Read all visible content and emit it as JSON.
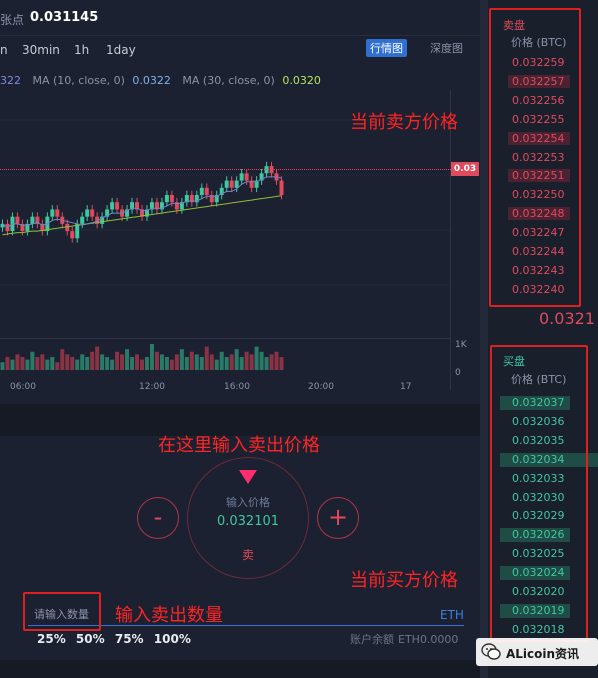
{
  "header": {
    "label": "张点",
    "price": "0.031145"
  },
  "intervals": [
    "n",
    "30min",
    "1h",
    "1day"
  ],
  "chart_tabs": {
    "active": "行情图",
    "inactive": "深度图"
  },
  "ma": {
    "ma_first_value": "322",
    "ma10_label": "MA (10, close, 0)",
    "ma10_value": "0.0322",
    "ma30_label": "MA (30, close, 0)",
    "ma30_value": "0.0320"
  },
  "current_price_tag": "0.03",
  "volume_axis": {
    "top": "1K",
    "bottom": "0"
  },
  "time_axis": [
    "06:00",
    "12:00",
    "16:00",
    "20:00",
    "17"
  ],
  "trade": {
    "price_label": "输入价格",
    "price_value": "0.032101",
    "side": "卖",
    "minus": "-",
    "plus": "+",
    "qty_placeholder": "请输入数量",
    "qty_unit": "ETH",
    "percents": [
      "25%",
      "50%",
      "75%",
      "100%"
    ],
    "balance_label": "账户余额",
    "balance_value": "ETH0.0000"
  },
  "orderbook": {
    "sell_title": "卖盘",
    "buy_title": "买盘",
    "price_header": "价格 (BTC)",
    "asks": [
      "0.032259",
      "0.032257",
      "0.032256",
      "0.032255",
      "0.032254",
      "0.032253",
      "0.032251",
      "0.032250",
      "0.032248",
      "0.032247",
      "0.032244",
      "0.032243",
      "0.032240"
    ],
    "last_price": "0.0321",
    "bids": [
      "0.032037",
      "0.032036",
      "0.032035",
      "0.032034",
      "0.032033",
      "0.032030",
      "0.032029",
      "0.032026",
      "0.032025",
      "0.032024",
      "0.032020",
      "0.032019",
      "0.032018"
    ]
  },
  "annotations": {
    "sell_price": "当前卖方价格",
    "enter_price": "在这里输入卖出价格",
    "buy_price": "当前买方价格",
    "enter_qty": "输入卖出数量"
  },
  "watermark": "ALicoin资讯",
  "colors": {
    "up": "#3ec7a0",
    "down": "#e04a5c",
    "accent": "#2f6fd0",
    "annotation": "#ff2424"
  },
  "chart_data": {
    "type": "candlestick",
    "closes": [
      0.0317,
      0.0316,
      0.0318,
      0.0317,
      0.0316,
      0.0317,
      0.0318,
      0.0317,
      0.0316,
      0.0318,
      0.0319,
      0.0318,
      0.0317,
      0.0316,
      0.0315,
      0.0317,
      0.0318,
      0.0319,
      0.0318,
      0.0317,
      0.0318,
      0.0319,
      0.032,
      0.0319,
      0.0318,
      0.0319,
      0.032,
      0.0319,
      0.0318,
      0.0319,
      0.032,
      0.0319,
      0.032,
      0.0321,
      0.032,
      0.0319,
      0.032,
      0.0321,
      0.032,
      0.0321,
      0.0322,
      0.0321,
      0.032,
      0.0321,
      0.0322,
      0.0323,
      0.0322,
      0.0323,
      0.0324,
      0.0323,
      0.0322,
      0.0323,
      0.0324,
      0.0325,
      0.0324,
      0.0323,
      0.0321
    ],
    "volumes": [
      3,
      5,
      4,
      6,
      5,
      4,
      7,
      5,
      6,
      4,
      5,
      3,
      8,
      6,
      5,
      4,
      6,
      5,
      7,
      9,
      6,
      5,
      4,
      7,
      6,
      8,
      5,
      6,
      4,
      5,
      10,
      7,
      6,
      5,
      4,
      6,
      8,
      5,
      7,
      6,
      5,
      9,
      6,
      4,
      7,
      5,
      6,
      8,
      5,
      7,
      6,
      9,
      7,
      5,
      6,
      7,
      5
    ],
    "ma_slow": [
      0.03155,
      0.03156,
      0.03157,
      0.03158,
      0.03158,
      0.03159,
      0.0316,
      0.0316,
      0.03161,
      0.03162,
      0.03163,
      0.03164,
      0.03165,
      0.03166,
      0.03167,
      0.03168,
      0.03169,
      0.0317,
      0.03171,
      0.03172,
      0.03173,
      0.03174,
      0.03175,
      0.03176,
      0.03177,
      0.03178,
      0.03179,
      0.0318,
      0.03181,
      0.03182,
      0.03183,
      0.03184,
      0.03185,
      0.03186,
      0.03187,
      0.03188,
      0.03189,
      0.0319,
      0.03191,
      0.03192,
      0.03193,
      0.03194,
      0.03195,
      0.03196,
      0.03197,
      0.03198,
      0.03199,
      0.032,
      0.03201,
      0.03202,
      0.03203,
      0.03204,
      0.03205,
      0.03206,
      0.03207,
      0.03208,
      0.03209
    ]
  }
}
